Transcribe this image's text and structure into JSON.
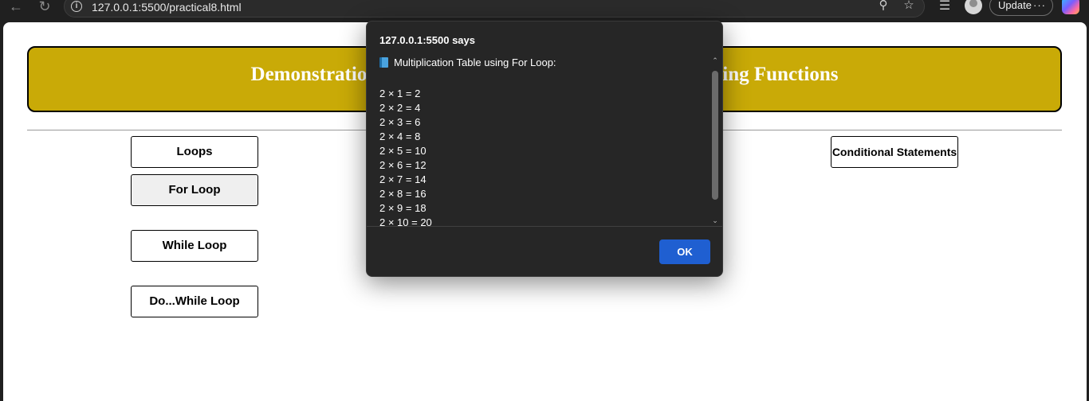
{
  "browser": {
    "url": "127.0.0.1:5500/practical8.html",
    "update_label": "Update",
    "more_label": "···"
  },
  "page": {
    "banner_title": "Demonstration of Loops and Conditional Statements using Functions",
    "buttons": {
      "loops": "Loops",
      "for_loop": "For Loop",
      "while_loop": "While Loop",
      "do_while_loop": "Do...While Loop",
      "conditional": "Conditional Statements"
    }
  },
  "dialog": {
    "title": "127.0.0.1:5500 says",
    "heading": "Multiplication Table using For Loop:",
    "lines": [
      "2 × 1 = 2",
      "2 × 2 = 4",
      "2 × 3 = 6",
      "2 × 4 = 8",
      "2 × 5 = 10",
      "2 × 6 = 12",
      "2 × 7 = 14",
      "2 × 8 = 16",
      "2 × 9 = 18",
      "2 × 10 = 20"
    ],
    "ok_label": "OK"
  },
  "colors": {
    "banner": "#c9aa07",
    "dialog_bg": "#262626",
    "ok_button": "#1f5fd1"
  }
}
